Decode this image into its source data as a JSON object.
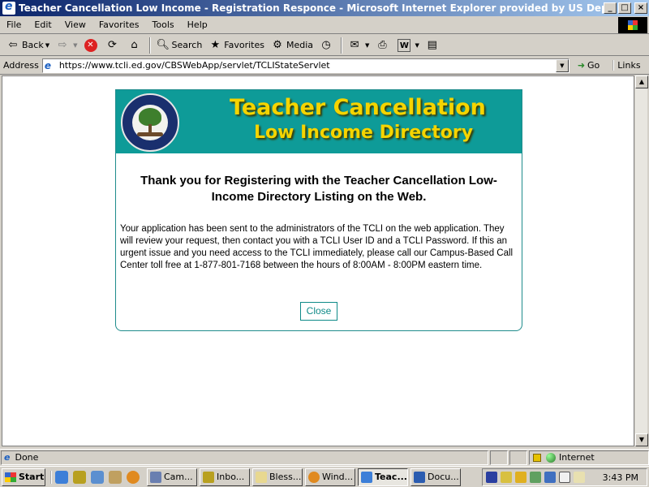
{
  "window": {
    "title": "Teacher Cancellation Low Income - Registration Responce - Microsoft Internet Explorer provided by US Department of Education",
    "min_glyph": "_",
    "max_glyph": "□",
    "close_glyph": "×"
  },
  "menu": [
    "File",
    "Edit",
    "View",
    "Favorites",
    "Tools",
    "Help"
  ],
  "toolbar": {
    "back": "Back",
    "search": "Search",
    "favorites": "Favorites",
    "media": "Media"
  },
  "address": {
    "label": "Address",
    "url": "https://www.tcli.ed.gov/CBSWebApp/servlet/TCLIStateServlet",
    "go": "Go",
    "links": "Links"
  },
  "page": {
    "banner_line1": "Teacher Cancellation",
    "banner_line2": "Low Income Directory",
    "heading": "Thank you for Registering with the Teacher Cancellation Low-Income Directory Listing on the Web.",
    "body": "Your application has been sent to the administrators of the TCLI on the web application. They will review your request, then contact you with a TCLI User ID and a TCLI Password. If this an urgent issue and you need access to the TCLI immediately, please call our Campus-Based Call Center toll free at 1-877-801-7168 between the hours of 8:00AM - 8:00PM eastern time.",
    "close_button": "Close"
  },
  "status": {
    "text": "Done",
    "zone": "Internet"
  },
  "taskbar": {
    "start": "Start",
    "tasks": [
      "Cam...",
      "Inbo...",
      "Bless...",
      "Wind...",
      "Teac...",
      "Docu..."
    ],
    "clock": "3:43 PM"
  },
  "colors": {
    "banner": "#0e9b98",
    "banner_text": "#f5d400",
    "accent": "#0e8a88",
    "titlebar": "#0a246a"
  }
}
